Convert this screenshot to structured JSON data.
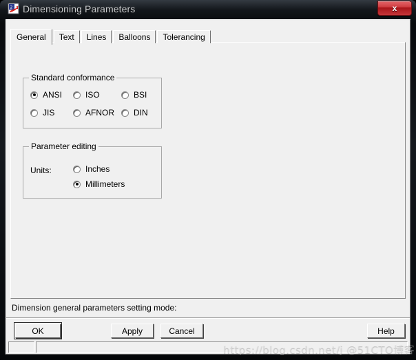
{
  "window": {
    "title": "Dimensioning Parameters",
    "icon": "catia-app-icon",
    "close_label": "x",
    "frame_color": "#0c0f13",
    "client_bg": "#f0f0f0"
  },
  "tabs": [
    {
      "label": "General",
      "selected": true
    },
    {
      "label": "Text",
      "selected": false
    },
    {
      "label": "Lines",
      "selected": false
    },
    {
      "label": "Balloons",
      "selected": false
    },
    {
      "label": "Tolerancing",
      "selected": false
    }
  ],
  "groups": {
    "standard_conformance": {
      "title": "Standard conformance",
      "options": [
        {
          "label": "ANSI",
          "checked": true
        },
        {
          "label": "ISO",
          "checked": false
        },
        {
          "label": "BSI",
          "checked": false
        },
        {
          "label": "JIS",
          "checked": false
        },
        {
          "label": "AFNOR",
          "checked": false
        },
        {
          "label": "DIN",
          "checked": false
        }
      ]
    },
    "parameter_editing": {
      "title": "Parameter editing",
      "units_label": "Units:",
      "options": [
        {
          "label": "Inches",
          "checked": false
        },
        {
          "label": "Millimeters",
          "checked": true
        }
      ]
    }
  },
  "status": {
    "message": "Dimension general parameters setting mode:"
  },
  "buttons": {
    "ok": "OK",
    "apply": "Apply",
    "cancel": "Cancel",
    "help": "Help"
  },
  "watermark": {
    "text": "https://blog.csdn.net/j @51CTO博客"
  }
}
